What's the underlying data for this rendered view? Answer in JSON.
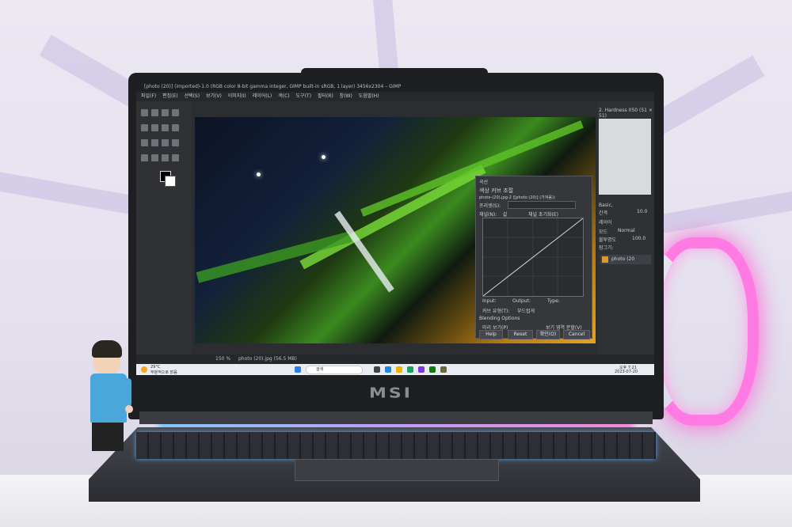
{
  "scene": {
    "subject": "laptop",
    "brand_logo": "MSI"
  },
  "app": {
    "title": "[photo (20)] (imported)-1.0 (RGB color 8-bit gamma integer, GIMP built-in sRGB, 1 layer) 3456x2304 – GIMP",
    "menu": [
      "파일(F)",
      "편집(E)",
      "선택(S)",
      "보기(V)",
      "이미지(I)",
      "레이어(L)",
      "색(C)",
      "도구(T)",
      "필터(R)",
      "창(W)",
      "도움말(H)"
    ],
    "status": {
      "zoom": "150 %",
      "file": "photo (20).jpg (56.5 MB)"
    },
    "right_panel": {
      "brush_name": "2. Hardness 050 (51 × 51)",
      "brush_preset": "Basic,",
      "spacing_label": "간격",
      "spacing_value": "10.0",
      "layers_tab": "레이어",
      "mode_label": "모드",
      "mode_value": "Normal",
      "opacity_label": "불투명도",
      "opacity_value": "100.0",
      "lock_label": "잠그기:",
      "layer_name": "photo (20"
    }
  },
  "dialog": {
    "header": "곡선",
    "title": "색상 커브 조절",
    "subtitle": "photo-(20).jpg-2 ([photo (20)] (가져옴))",
    "preset_label": "프리셋(S):",
    "channel_label": "채널(N):",
    "channel_value": "값",
    "reset_channel": "채널 초기화(E)",
    "input_label": "Input:",
    "output_label": "Output:",
    "type_label": "Type:",
    "curve_type_label": "커브 유형(T):",
    "curve_type_value": "부드럽게",
    "blending": "Blending Options",
    "preview_label": "미리 보기(P)",
    "split_view": "보기 영역 분할(V)",
    "buttons": {
      "help": "Help",
      "reset": "Reset",
      "ok": "확인(O)",
      "cancel": "Cancel"
    }
  },
  "taskbar": {
    "weather_temp": "29°C",
    "weather_text": "부분적으로 맑음",
    "search_label": "검색",
    "time": "오후 7:21",
    "date": "2023-07-20"
  },
  "colors": {
    "ring_light": "#ff7be3",
    "shirt": "#4aa7dc",
    "canvas_green": "#7adf3a",
    "canvas_orange": "#e6a321"
  }
}
